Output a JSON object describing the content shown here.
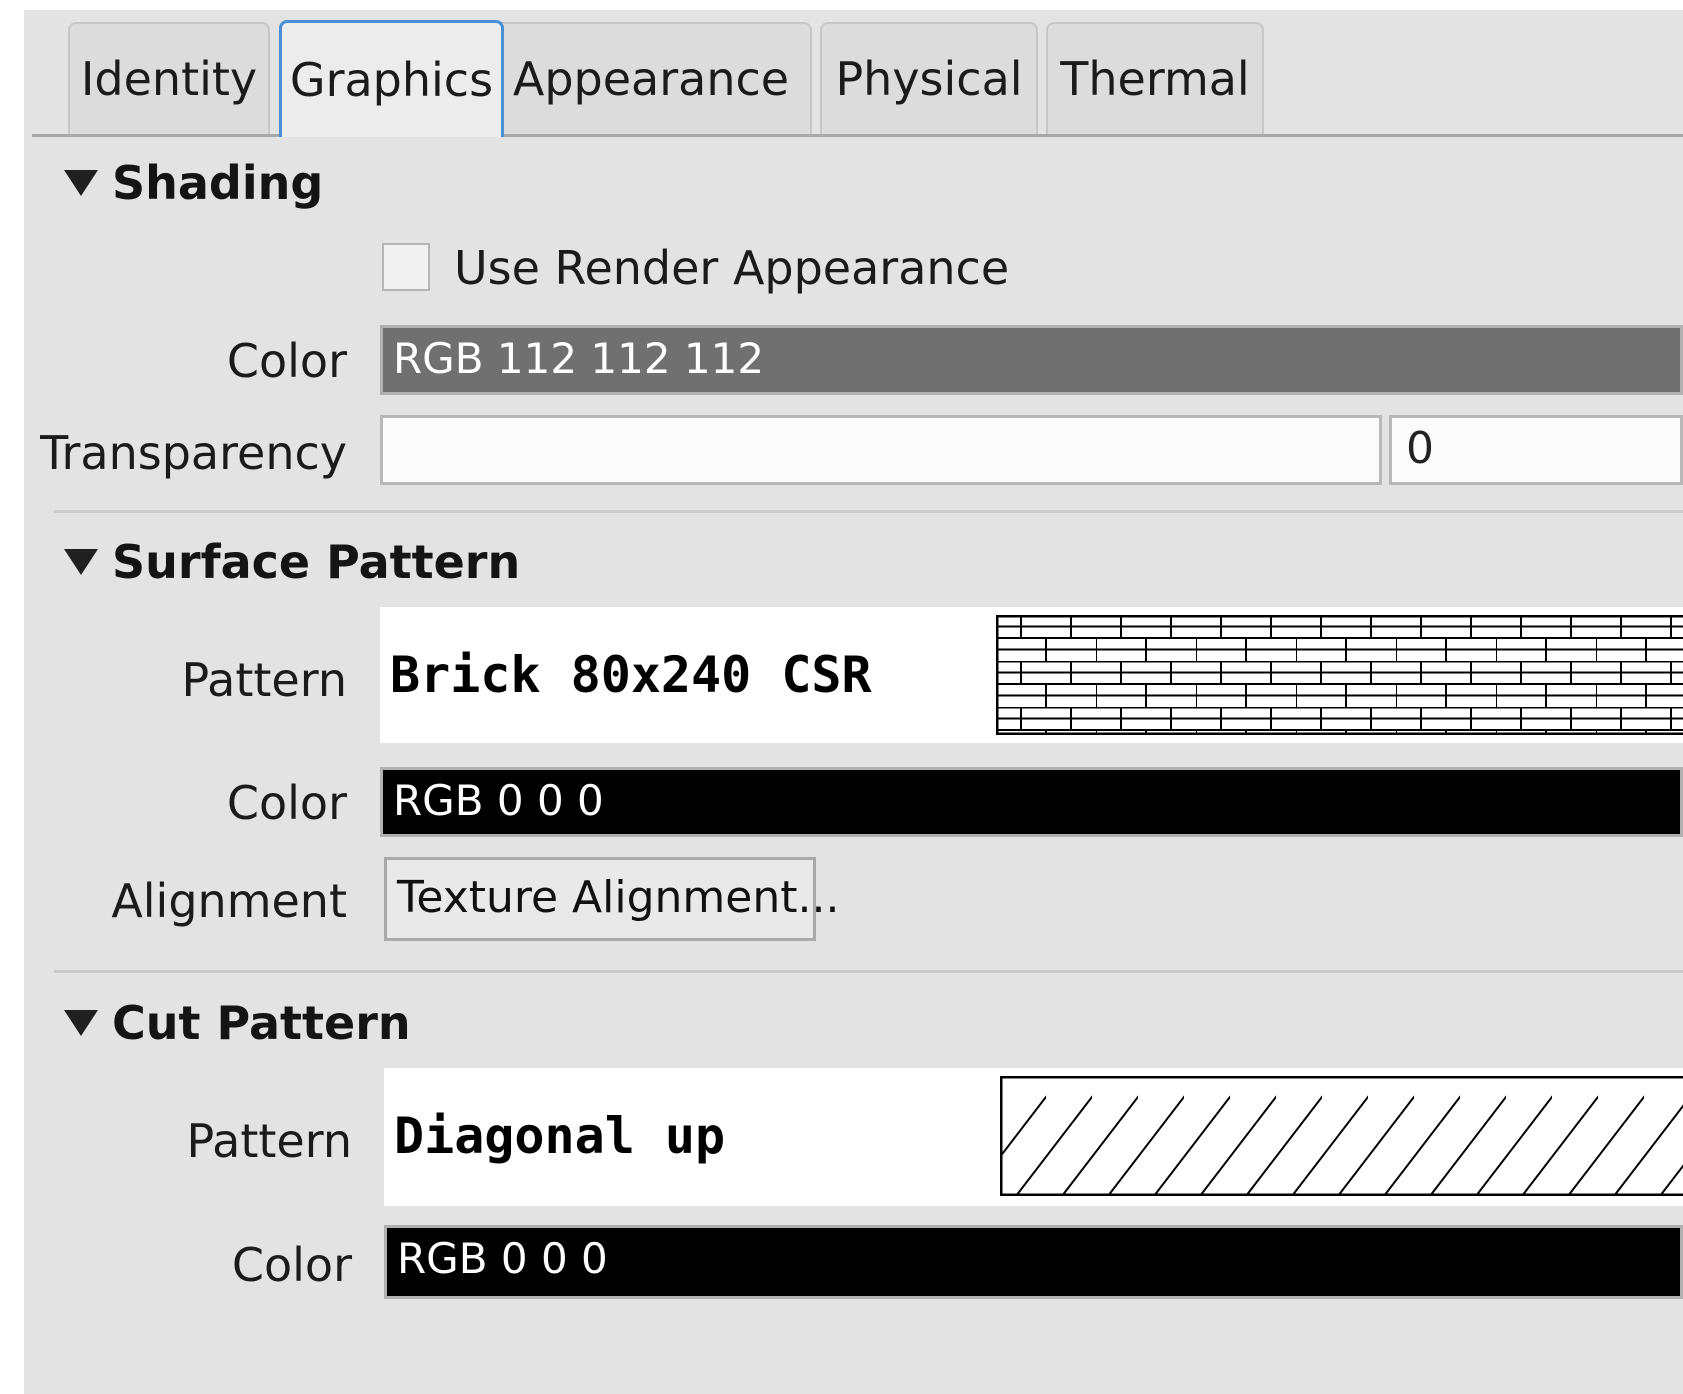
{
  "tabs": [
    {
      "label": "Identity"
    },
    {
      "label": "Graphics"
    },
    {
      "label": "Appearance"
    },
    {
      "label": "Physical"
    },
    {
      "label": "Thermal"
    }
  ],
  "active_tab": "Graphics",
  "shading": {
    "title": "Shading",
    "use_render_appearance_label": "Use Render Appearance",
    "use_render_appearance_checked": false,
    "color_label": "Color",
    "color_value": "RGB 112 112 112",
    "color_hex": "#707070",
    "transparency_label": "Transparency",
    "transparency_value": "0"
  },
  "surface_pattern": {
    "title": "Surface Pattern",
    "pattern_label": "Pattern",
    "pattern_name": "Brick 80x240 CSR",
    "pattern_icon": "brick-hatch",
    "color_label": "Color",
    "color_value": "RGB 0 0 0",
    "color_hex": "#000000",
    "alignment_label": "Alignment",
    "alignment_button": "Texture Alignment..."
  },
  "cut_pattern": {
    "title": "Cut Pattern",
    "pattern_label": "Pattern",
    "pattern_name": "Diagonal up",
    "pattern_icon": "diagonal-hatch",
    "color_label": "Color",
    "color_value": "RGB 0 0 0",
    "color_hex": "#000000"
  },
  "colors": {
    "panel_bg": "#e3e3e3",
    "active_tab_border": "#4b8fd6"
  }
}
